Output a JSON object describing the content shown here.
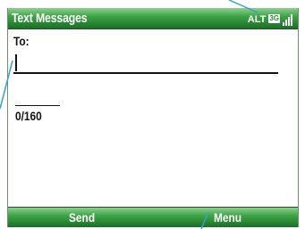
{
  "window": {
    "title": "Text Messages"
  },
  "status": {
    "network": "ALT",
    "badge": "3G"
  },
  "form": {
    "to_label": "To:",
    "to_value": "",
    "char_counter": "0/160"
  },
  "softkeys": {
    "left": "Send",
    "right": "Menu"
  },
  "colors": {
    "bar_green": "#2b8a36",
    "callout": "#3aa0c8"
  },
  "icons": {
    "signal": "signal-strength-icon",
    "badge": "3g-badge-icon"
  }
}
